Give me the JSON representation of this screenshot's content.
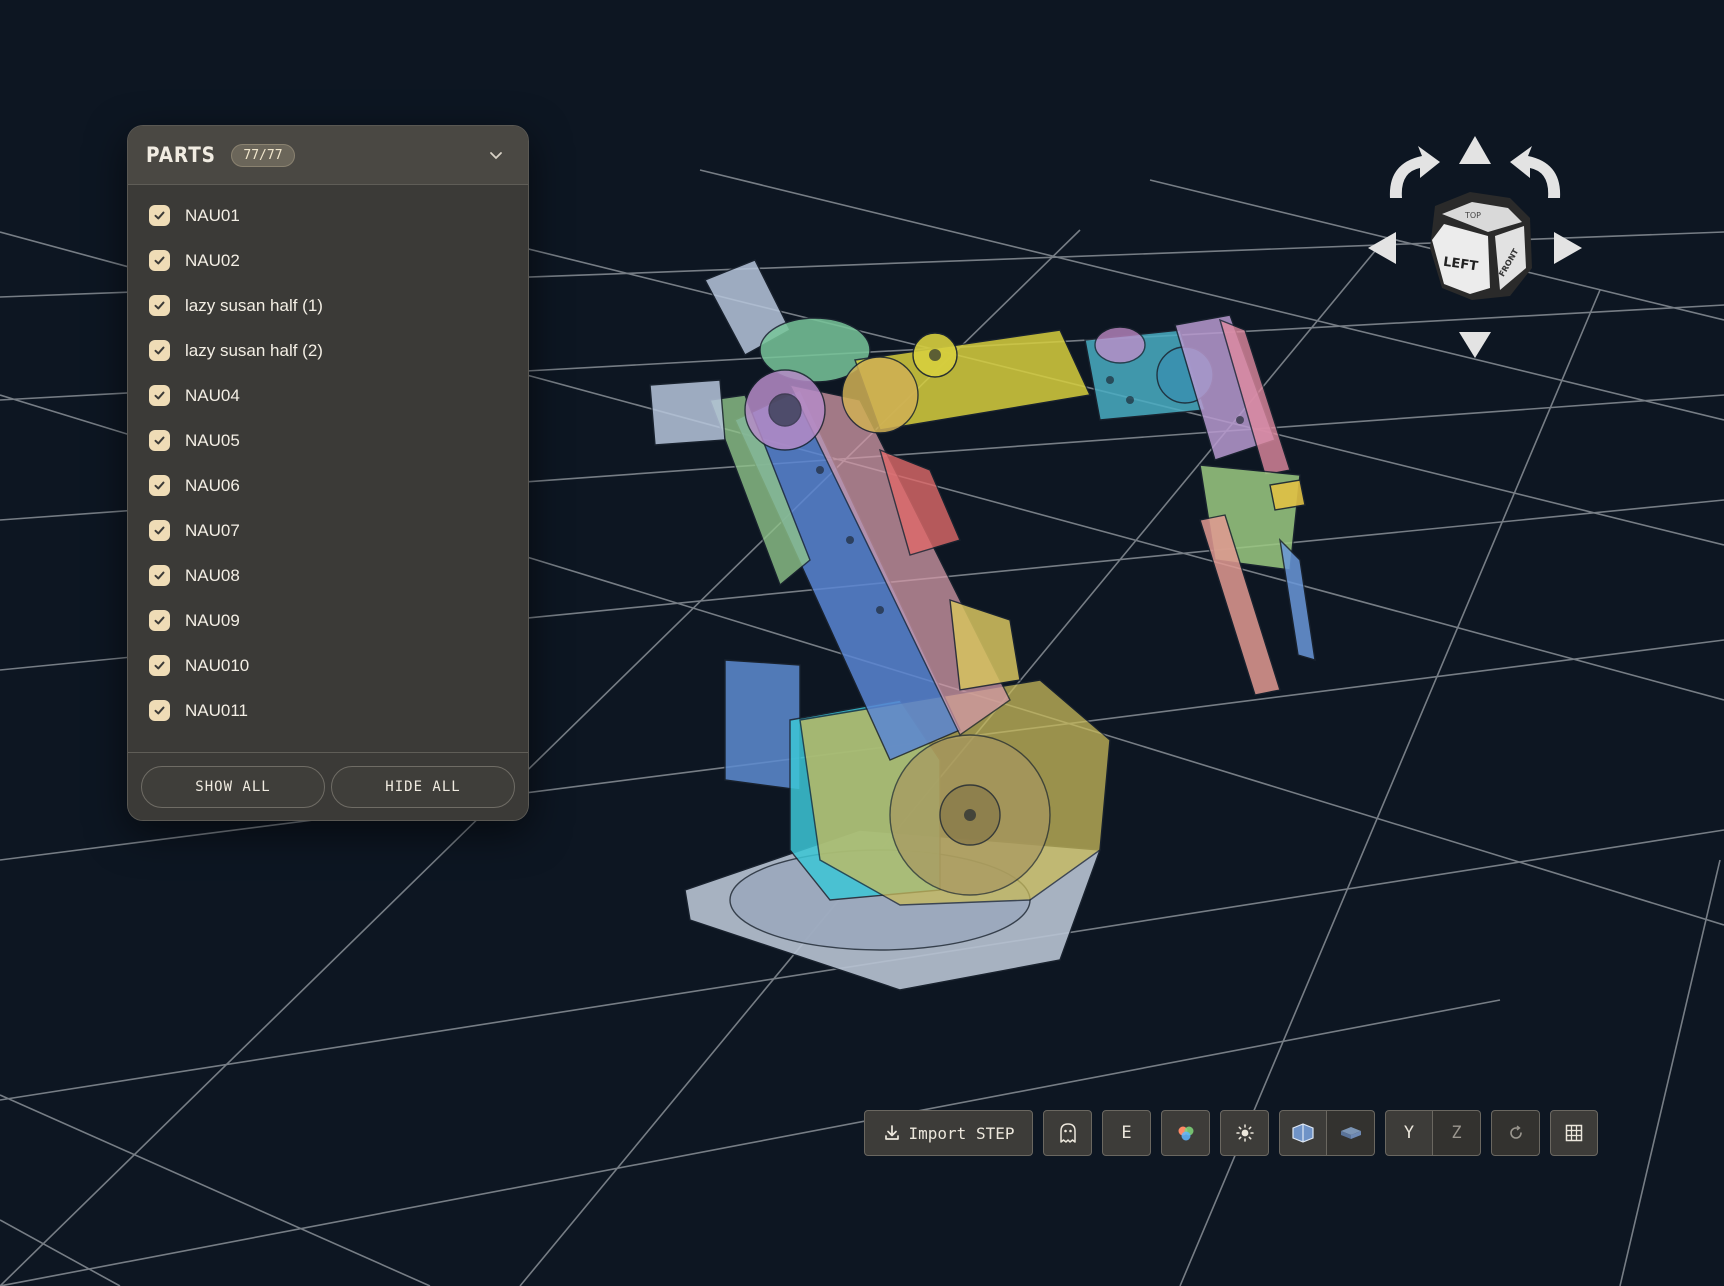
{
  "parts_panel": {
    "title": "PARTS",
    "count": "77/77",
    "items": [
      {
        "label": "NAU01",
        "checked": true
      },
      {
        "label": "NAU02",
        "checked": true
      },
      {
        "label": "lazy susan half (1)",
        "checked": true
      },
      {
        "label": "lazy susan half (2)",
        "checked": true
      },
      {
        "label": "NAU04",
        "checked": true
      },
      {
        "label": "NAU05",
        "checked": true
      },
      {
        "label": "NAU06",
        "checked": true
      },
      {
        "label": "NAU07",
        "checked": true
      },
      {
        "label": "NAU08",
        "checked": true
      },
      {
        "label": "NAU09",
        "checked": true
      },
      {
        "label": "NAU010",
        "checked": true
      },
      {
        "label": "NAU011",
        "checked": true
      }
    ],
    "show_all_label": "SHOW ALL",
    "hide_all_label": "HIDE ALL"
  },
  "view_cube": {
    "face_left": "LEFT",
    "face_front": "FRONT",
    "face_top": "TOP"
  },
  "toolbar": {
    "import_label": "Import STEP",
    "explode_label": "E",
    "axis_y_label": "Y",
    "axis_z_label": "Z",
    "icons": [
      "download-icon",
      "ghost-icon",
      "color-palette-icon",
      "light-icon",
      "perspective-cube-icon",
      "orthographic-cube-icon",
      "rotate-icon",
      "grid-icon"
    ]
  },
  "colors": {
    "background": "#0d1622",
    "grid_line": "#8b9097",
    "panel": "#3b3a37",
    "checkbox": "#efdcb6"
  }
}
